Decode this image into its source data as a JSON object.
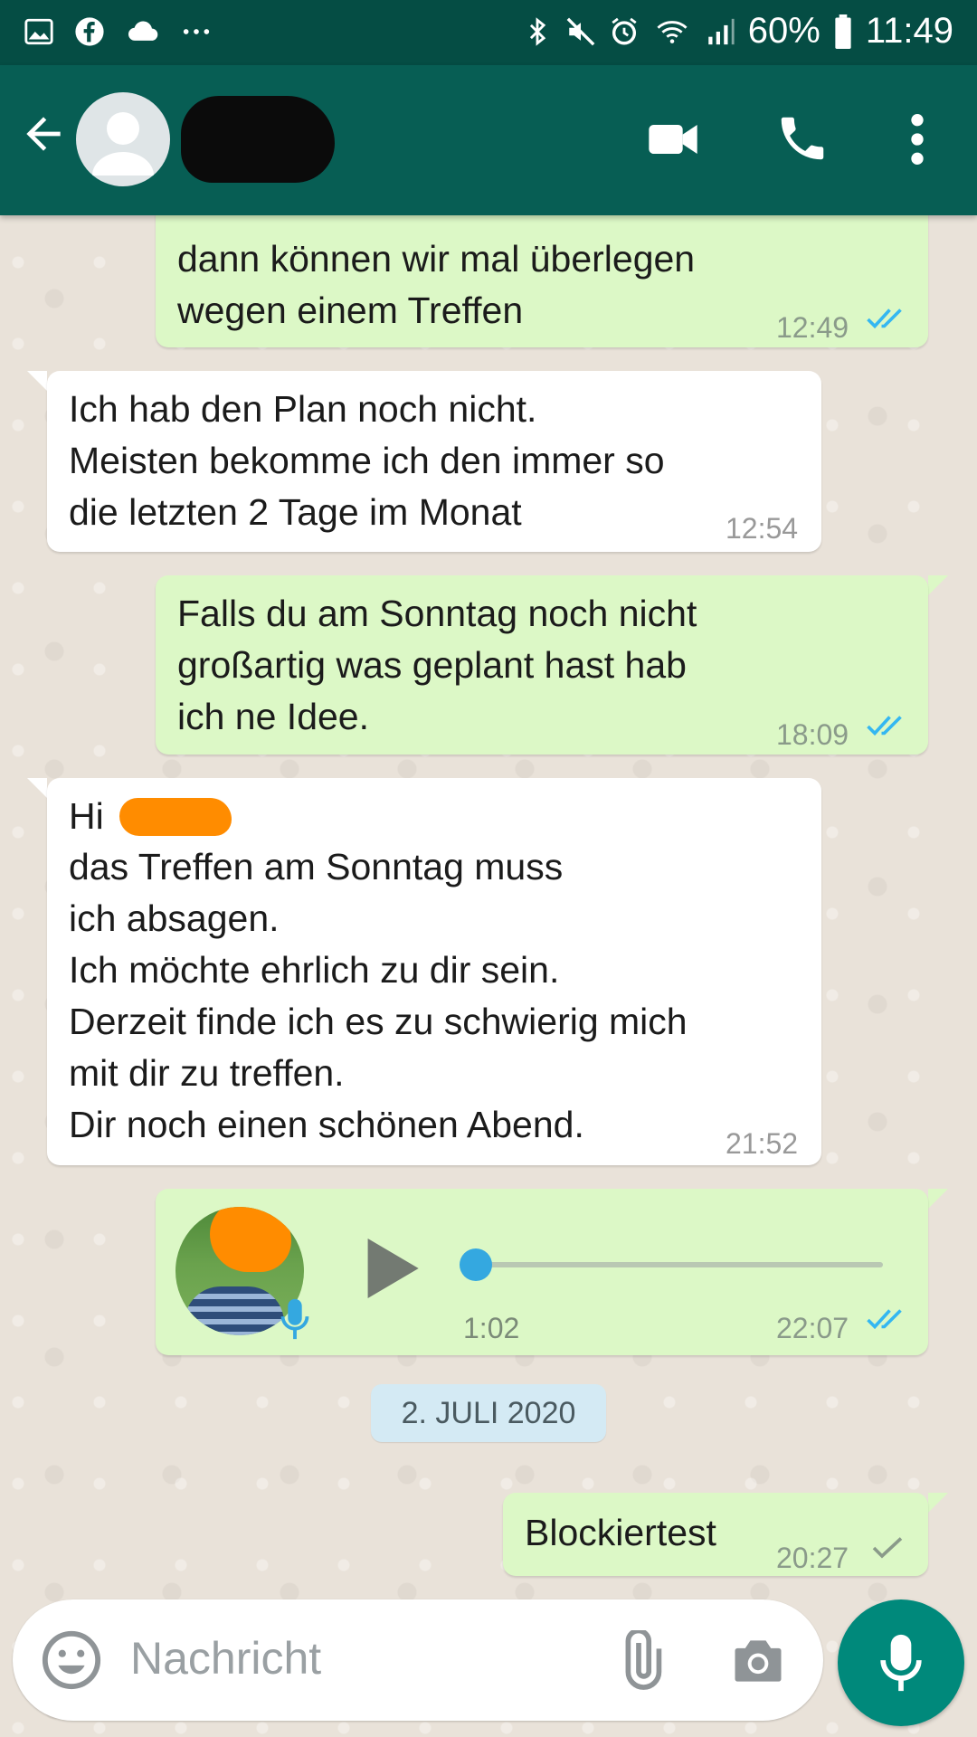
{
  "status_bar": {
    "icons_left": [
      "gallery-icon",
      "facebook-icon",
      "cloud-icon",
      "more-notifications-icon"
    ],
    "icons_right": [
      "bluetooth-icon",
      "mute-icon",
      "alarm-icon",
      "wifi-icon",
      "signal-icon",
      "battery-icon"
    ],
    "battery": "60%",
    "time": "11:49"
  },
  "header": {
    "icons": [
      "back-arrow-icon",
      "avatar-icon",
      "video-call-icon",
      "phone-icon",
      "more-vert-icon"
    ]
  },
  "messages": [
    {
      "direction": "out",
      "text": "dann können wir mal überlegen\nwegen einem Treffen",
      "time": "12:49",
      "status": "read"
    },
    {
      "direction": "in",
      "text": "Ich hab den Plan noch nicht.\nMeisten bekomme ich den immer so\ndie letzten 2 Tage im Monat",
      "time": "12:54"
    },
    {
      "direction": "out",
      "text": "Falls du am Sonntag noch nicht\ngroßartig was geplant hast hab\nich ne Idee.",
      "time": "18:09",
      "status": "read"
    },
    {
      "direction": "in",
      "greeting": "Hi",
      "text": "das Treffen am Sonntag muss\nich absagen.\nIch möchte ehrlich zu dir sein.\nDerzeit finde ich es zu schwierig mich\nmit dir zu treffen.\nDir noch einen schönen Abend.",
      "time": "21:52"
    },
    {
      "direction": "out",
      "type": "voice",
      "duration": "1:02",
      "time": "22:07",
      "status": "read",
      "progress": 0
    }
  ],
  "date_divider": "2. JULI 2020",
  "last_message": {
    "direction": "out",
    "text": "Blockiertest",
    "time": "20:27",
    "status": "sent"
  },
  "input": {
    "placeholder": "Nachricht",
    "icons": [
      "emoji-icon",
      "attach-icon",
      "camera-icon",
      "mic-icon"
    ]
  },
  "colors": {
    "status_bar": "#054d44",
    "header": "#075e54",
    "outgoing_bubble": "#dcf8c6",
    "incoming_bubble": "#ffffff",
    "read_ticks": "#34b7f1",
    "mic_button": "#00897b",
    "redaction_orange": "#ff8c00"
  }
}
